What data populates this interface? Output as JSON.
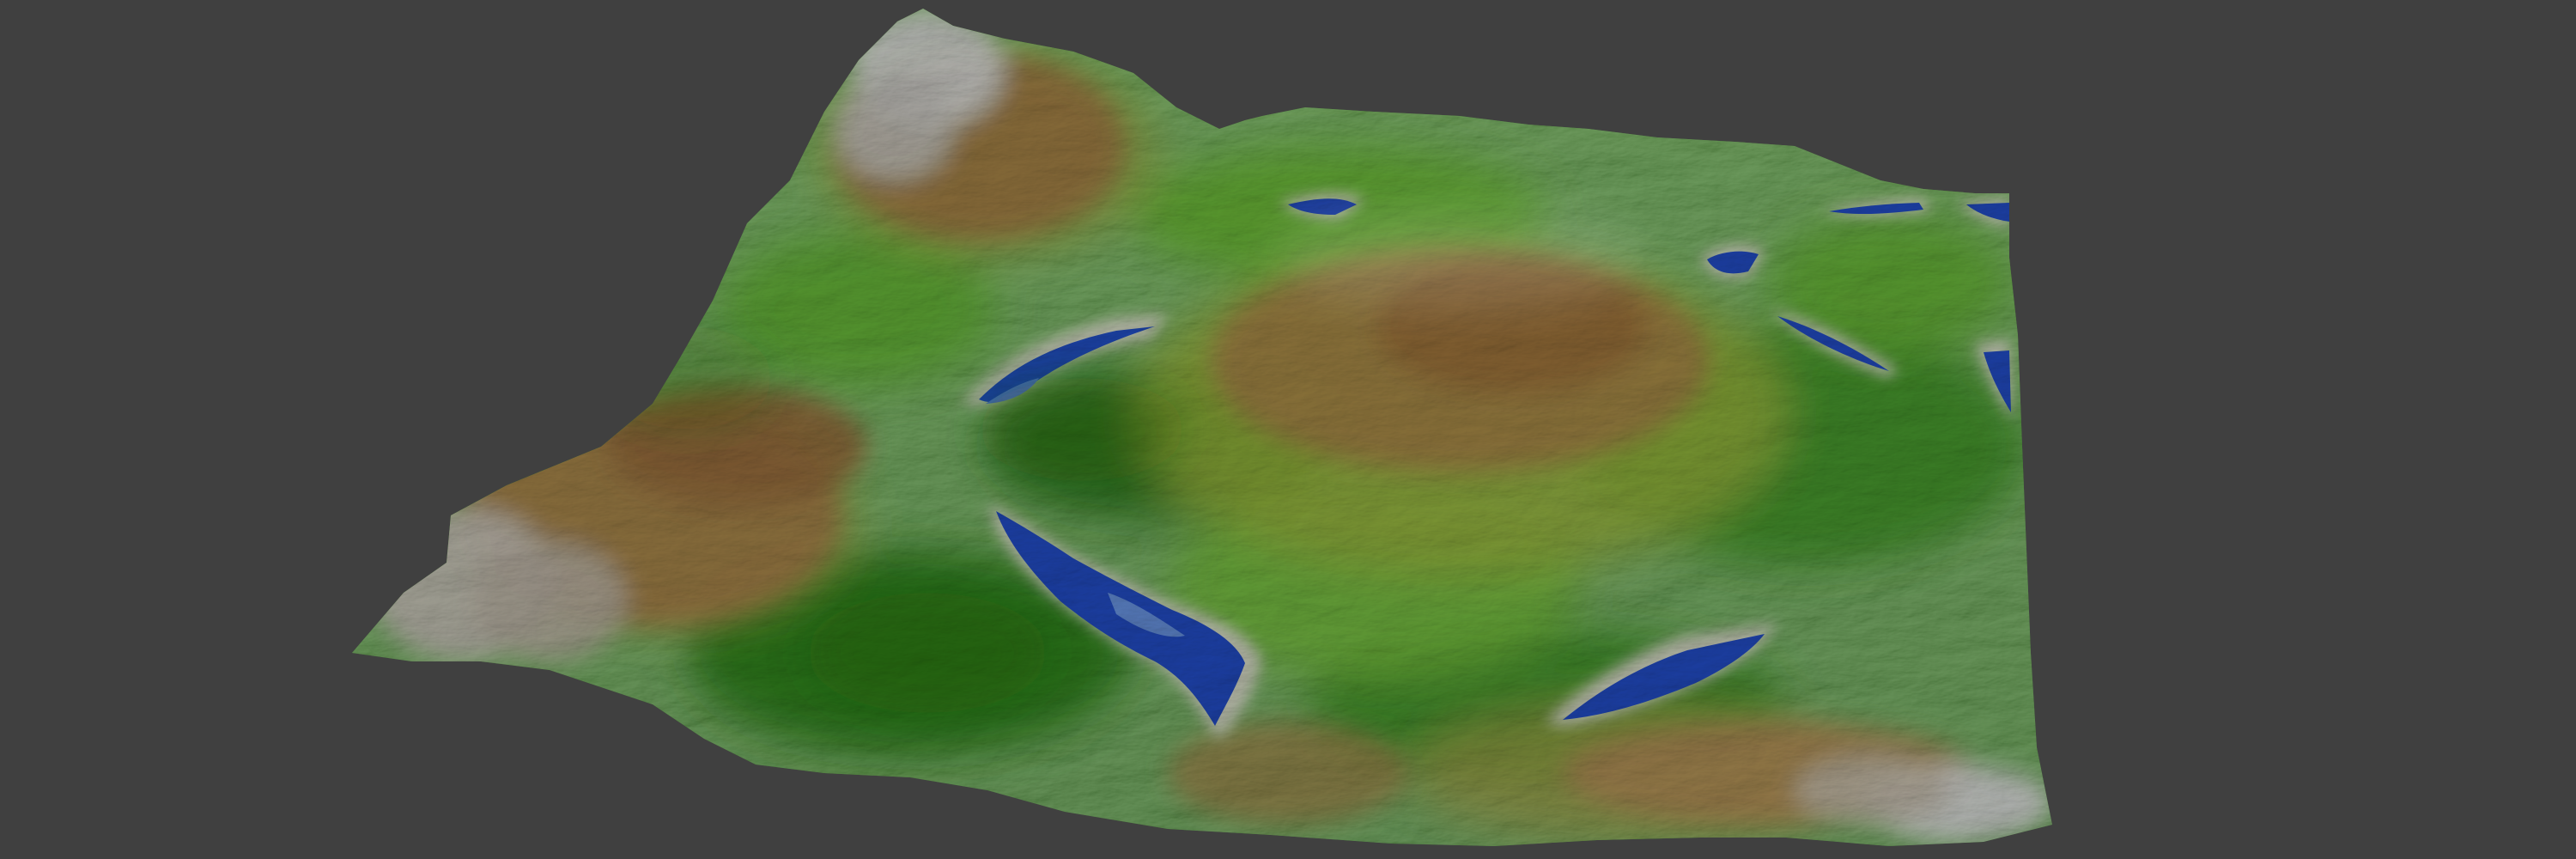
{
  "scene": {
    "background_color": "#404040",
    "subject": "3d-terrain-heightmap"
  },
  "colors": {
    "water_deep": "#1f4fd1",
    "water_shallow": "#5f8ff0",
    "shore": "#e9ecd8",
    "lowland_green": "#2f8f1a",
    "mid_green": "#4fb22a",
    "bright_green": "#72c83a",
    "yellow_green": "#b3c843",
    "tan": "#b88a4a",
    "brown": "#9a6a36",
    "rock_light": "#d7d2c8",
    "snow": "#f2f2f2"
  }
}
